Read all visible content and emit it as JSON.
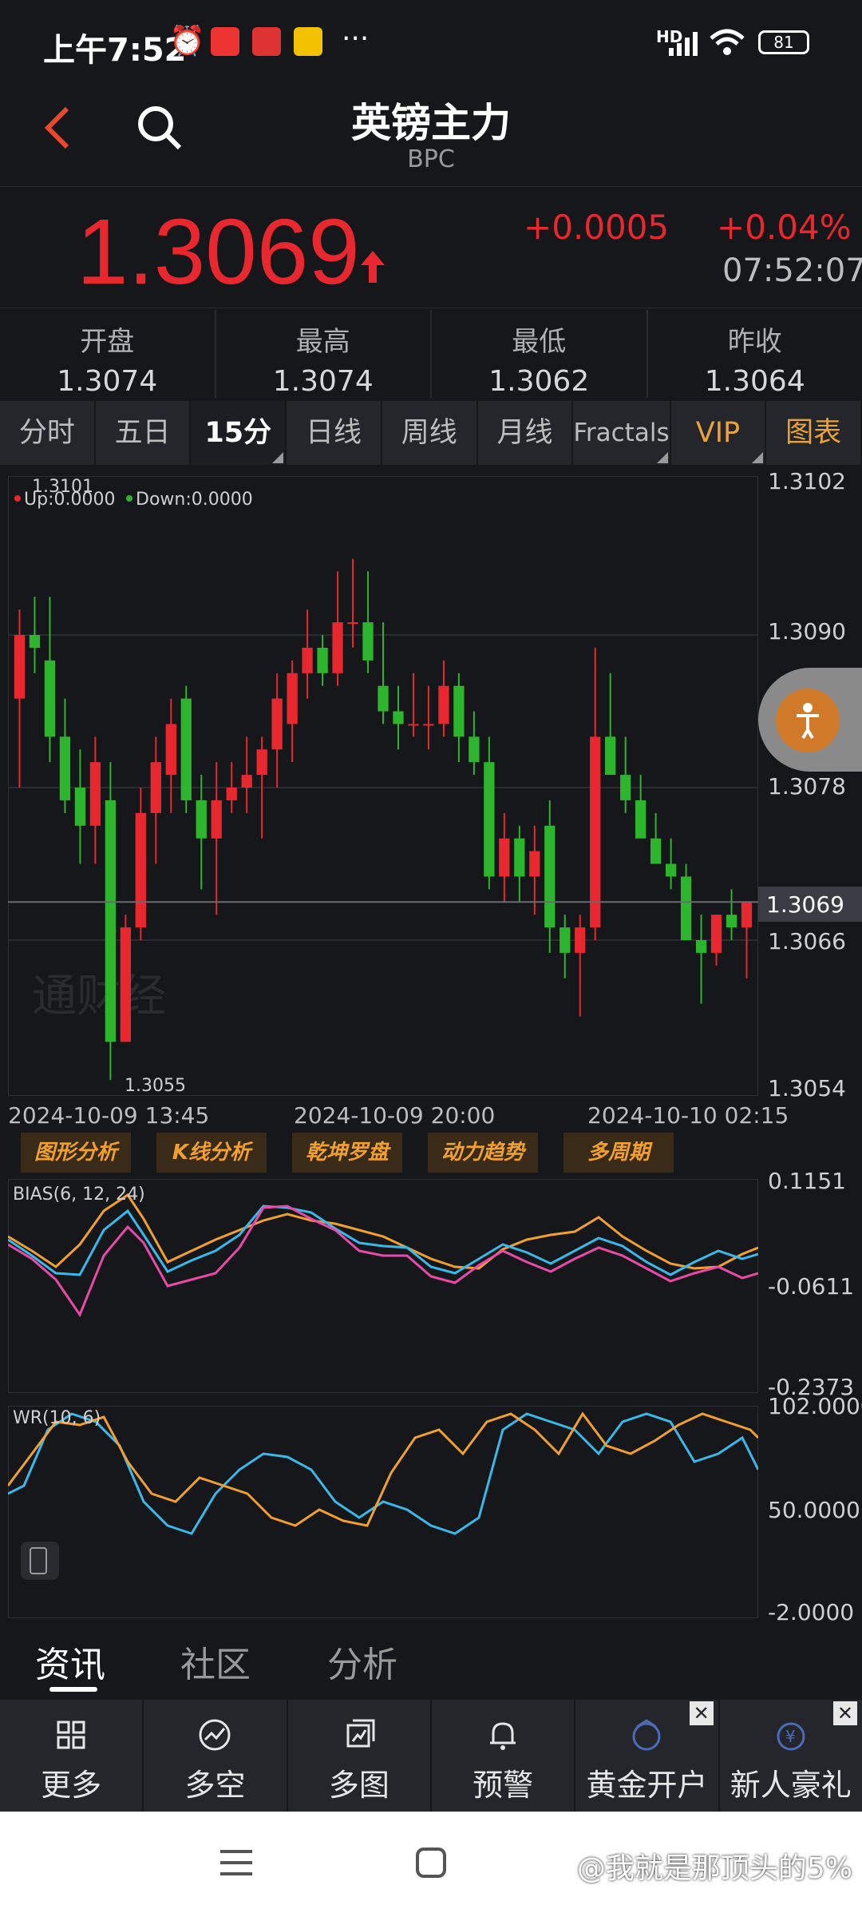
{
  "status_bar": {
    "time": "上午7:52",
    "battery": "81",
    "network": "HD"
  },
  "header": {
    "title": "英镑主力",
    "subtitle": "BPC"
  },
  "quote": {
    "price": "1.3069",
    "change": "+0.0005",
    "change_pct": "+0.04%",
    "time": "07:52:07"
  },
  "ohlc": [
    {
      "label": "开盘",
      "value": "1.3074"
    },
    {
      "label": "最高",
      "value": "1.3074"
    },
    {
      "label": "最低",
      "value": "1.3062"
    },
    {
      "label": "昨收",
      "value": "1.3064"
    }
  ],
  "tabs": [
    "分时",
    "五日",
    "15分钟",
    "日线",
    "周线",
    "月线",
    "Fractals",
    "VIP",
    "图表"
  ],
  "main_chart": {
    "legend_up": "Up:0.0000",
    "legend_down": "Down:0.0000",
    "y_labels": [
      "1.3102",
      "1.3090",
      "1.3078",
      "1.3069",
      "1.3066",
      "1.3054"
    ],
    "high_label": "1.3101",
    "low_label": "1.3055",
    "current_price": "1.3069",
    "watermark": "通财经",
    "dates": [
      "2024-10-09 13:45",
      "2024-10-09 20:00",
      "2024-10-10 02:15"
    ]
  },
  "analysis_buttons": [
    "图形分析",
    "K线分析",
    "乾坤罗盘",
    "动力趋势",
    "多周期"
  ],
  "bias": {
    "title": "BIAS(6, 12, 24)",
    "y_labels": [
      "0.1151",
      "-0.0611",
      "-0.2373"
    ]
  },
  "wr": {
    "title": "WR(10, 6)",
    "y_labels": [
      "102.0000",
      "50.0000",
      "-2.0000"
    ]
  },
  "info_tabs": [
    "资讯",
    "社区",
    "分析"
  ],
  "toolbar": [
    {
      "label": "更多",
      "icon": "grid-icon"
    },
    {
      "label": "多空",
      "icon": "trend-icon"
    },
    {
      "label": "多图",
      "icon": "multichart-icon"
    },
    {
      "label": "预警",
      "icon": "bell-icon"
    },
    {
      "label": "黄金开户",
      "icon": "gold-account-icon"
    },
    {
      "label": "新人豪礼",
      "icon": "gift-icon"
    }
  ],
  "watermark_user": "@我就是那顶头的5%",
  "colors": {
    "up": "#e8282e",
    "down": "#2db52d",
    "accent": "#e8a33a",
    "bg": "#16171b"
  },
  "chart_data": {
    "type": "candlestick",
    "ylim": [
      1.3054,
      1.3102
    ],
    "candles": [
      [
        1.3085,
        1.3092,
        1.3078,
        1.309
      ],
      [
        1.309,
        1.3093,
        1.3087,
        1.3089
      ],
      [
        1.3088,
        1.3093,
        1.308,
        1.3082
      ],
      [
        1.3082,
        1.3085,
        1.3076,
        1.3077
      ],
      [
        1.3078,
        1.3081,
        1.3072,
        1.3075
      ],
      [
        1.3075,
        1.3082,
        1.3072,
        1.308
      ],
      [
        1.3077,
        1.308,
        1.3055,
        1.3058
      ],
      [
        1.3058,
        1.3068,
        1.3058,
        1.3067
      ],
      [
        1.3067,
        1.3078,
        1.3066,
        1.3076
      ],
      [
        1.3076,
        1.3082,
        1.3072,
        1.308
      ],
      [
        1.3079,
        1.3085,
        1.3076,
        1.3083
      ],
      [
        1.3085,
        1.3086,
        1.3076,
        1.3077
      ],
      [
        1.3077,
        1.3079,
        1.307,
        1.3074
      ],
      [
        1.3074,
        1.308,
        1.3068,
        1.3077
      ],
      [
        1.3077,
        1.308,
        1.3076,
        1.3078
      ],
      [
        1.3078,
        1.3082,
        1.3076,
        1.3079
      ],
      [
        1.3079,
        1.3082,
        1.3074,
        1.3081
      ],
      [
        1.3081,
        1.3087,
        1.3078,
        1.3085
      ],
      [
        1.3083,
        1.3088,
        1.308,
        1.3087
      ],
      [
        1.3087,
        1.3092,
        1.3085,
        1.3089
      ],
      [
        1.3089,
        1.309,
        1.3086,
        1.3087
      ],
      [
        1.3087,
        1.3095,
        1.3086,
        1.3091
      ],
      [
        1.3091,
        1.3096,
        1.3089,
        1.3091
      ],
      [
        1.3091,
        1.3095,
        1.3087,
        1.3088
      ],
      [
        1.3086,
        1.3091,
        1.3083,
        1.3084
      ],
      [
        1.3084,
        1.3086,
        1.3081,
        1.3083
      ],
      [
        1.3083,
        1.3087,
        1.3082,
        1.3083
      ],
      [
        1.3083,
        1.3086,
        1.3081,
        1.3083
      ],
      [
        1.3083,
        1.3088,
        1.3082,
        1.3086
      ],
      [
        1.3086,
        1.3087,
        1.308,
        1.3082
      ],
      [
        1.3082,
        1.3084,
        1.3079,
        1.308
      ],
      [
        1.308,
        1.3082,
        1.307,
        1.3071
      ],
      [
        1.3071,
        1.3076,
        1.3069,
        1.3074
      ],
      [
        1.3074,
        1.3075,
        1.3069,
        1.3071
      ],
      [
        1.3071,
        1.3075,
        1.3068,
        1.3073
      ],
      [
        1.3075,
        1.3077,
        1.3065,
        1.3067
      ],
      [
        1.3067,
        1.3068,
        1.3063,
        1.3065
      ],
      [
        1.3065,
        1.3068,
        1.306,
        1.3067
      ],
      [
        1.3067,
        1.3089,
        1.3066,
        1.3082
      ],
      [
        1.3082,
        1.3087,
        1.308,
        1.3079
      ],
      [
        1.3079,
        1.3082,
        1.3076,
        1.3077
      ],
      [
        1.3077,
        1.3079,
        1.3074,
        1.3074
      ],
      [
        1.3074,
        1.3076,
        1.3072,
        1.3072
      ],
      [
        1.3072,
        1.3074,
        1.307,
        1.3071
      ],
      [
        1.3071,
        1.3072,
        1.3067,
        1.3066
      ],
      [
        1.3066,
        1.3068,
        1.3061,
        1.3065
      ],
      [
        1.3065,
        1.3068,
        1.3064,
        1.3068
      ],
      [
        1.3068,
        1.307,
        1.3066,
        1.3067
      ],
      [
        1.3067,
        1.3069,
        1.3063,
        1.3069
      ]
    ]
  }
}
